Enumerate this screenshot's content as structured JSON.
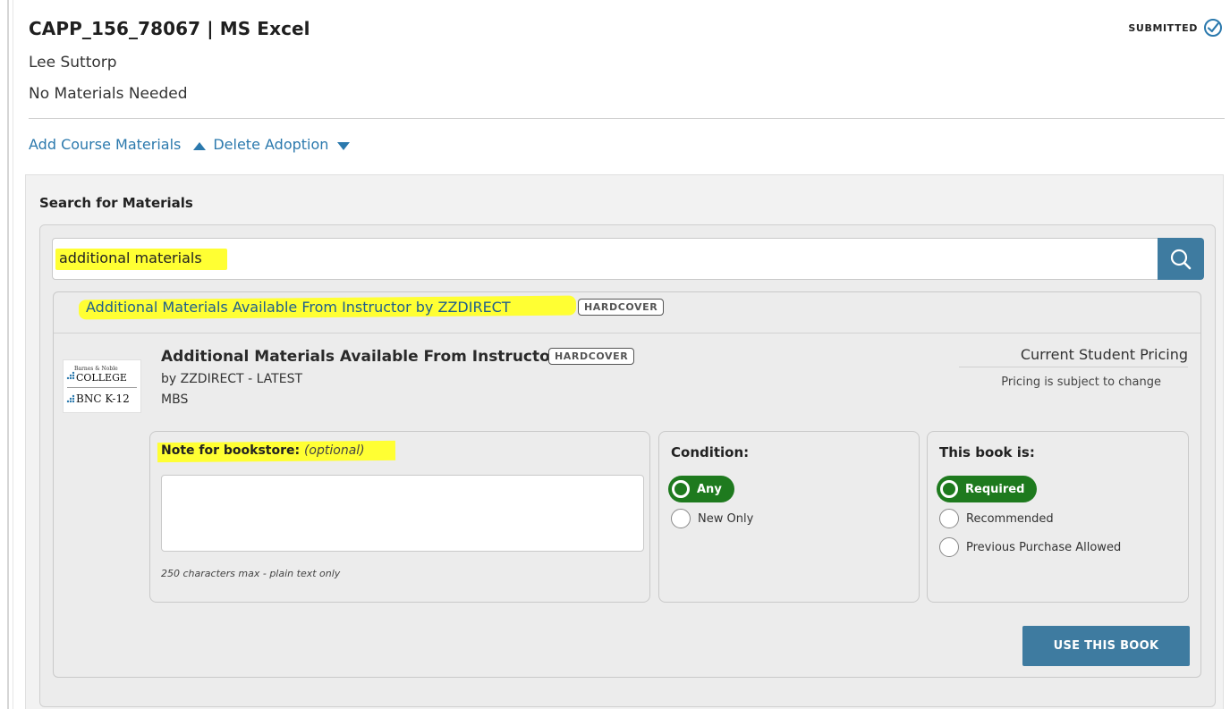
{
  "course": {
    "title": "CAPP_156_78067 | MS Excel",
    "instructor": "Lee Suttorp",
    "materials_status": "No Materials Needed",
    "status_label": "SUBMITTED"
  },
  "actions": {
    "add_materials": "Add Course Materials",
    "delete_adoption": "Delete Adoption"
  },
  "search": {
    "heading": "Search for Materials",
    "query": "additional materials",
    "highlight_color": "#ffff33",
    "button_color": "#3e7ba0"
  },
  "result": {
    "title": "Additional Materials Available From Instructor by ZZDIRECT",
    "format": "HARDCOVER"
  },
  "book": {
    "title": "Additional Materials Available From Instructor",
    "format": "HARDCOVER",
    "author_line": "by ZZDIRECT - LATEST",
    "publisher": "MBS",
    "logo_text_1": "Barnes & Noble",
    "logo_text_2": "COLLEGE",
    "logo_text_3": "BNC K-12",
    "pricing_heading": "Current Student Pricing",
    "pricing_note": "Pricing is subject to change"
  },
  "note": {
    "label": "Note for bookstore:",
    "optional": "(optional)",
    "value": "",
    "help": "250 characters max - plain text only"
  },
  "condition": {
    "label": "Condition:",
    "options": [
      "Any",
      "New Only"
    ],
    "selected": "Any"
  },
  "requirement": {
    "label": "This book is:",
    "options": [
      "Required",
      "Recommended",
      "Previous Purchase Allowed"
    ],
    "selected": "Required"
  },
  "submit": {
    "label": "USE THIS BOOK"
  }
}
